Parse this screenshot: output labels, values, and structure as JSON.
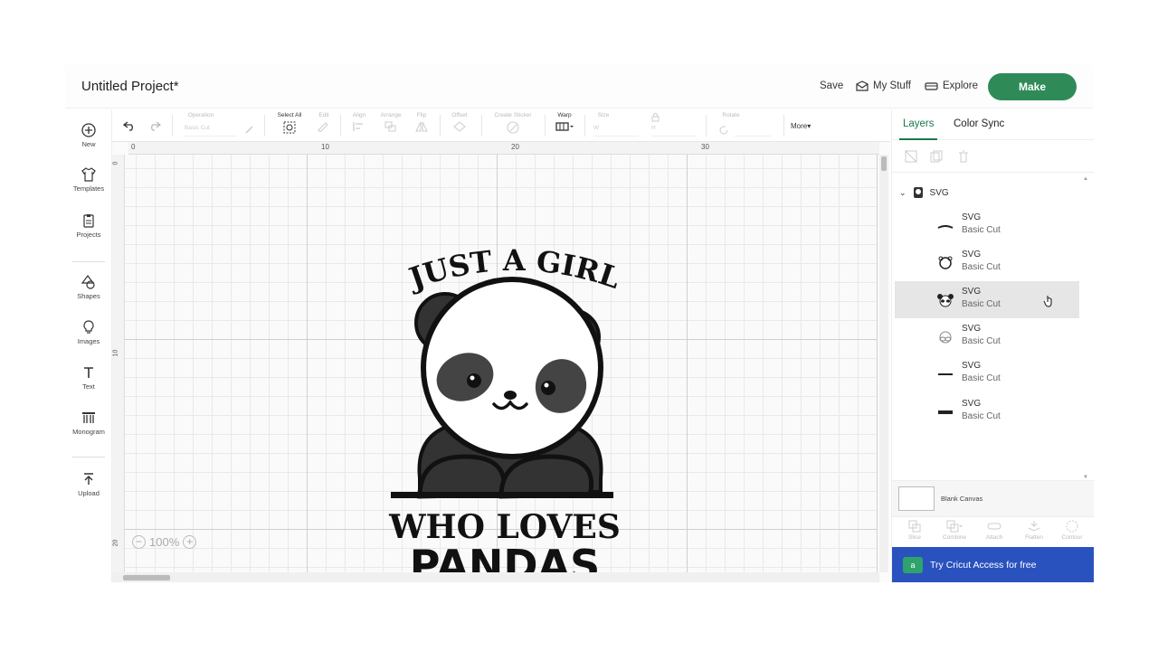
{
  "header": {
    "project_title": "Untitled Project*",
    "save_label": "Save",
    "my_stuff_label": "My Stuff",
    "explore_label": "Explore",
    "make_label": "Make"
  },
  "sidebar": {
    "items": [
      {
        "label": "New",
        "icon": "plus-circle-icon"
      },
      {
        "label": "Templates",
        "icon": "shirt-icon"
      },
      {
        "label": "Projects",
        "icon": "clipboard-icon"
      },
      {
        "label": "Shapes",
        "icon": "shapes-icon"
      },
      {
        "label": "Images",
        "icon": "lightbulb-icon"
      },
      {
        "label": "Text",
        "icon": "text-icon"
      },
      {
        "label": "Monogram",
        "icon": "monogram-icon"
      },
      {
        "label": "Upload",
        "icon": "upload-icon"
      }
    ]
  },
  "toolbar": {
    "operation_label": "Operation",
    "operation_value": "Basic Cut",
    "select_all_label": "Select All",
    "edit_label": "Edit",
    "align_label": "Align",
    "arrange_label": "Arrange",
    "flip_label": "Flip",
    "offset_label": "Offset",
    "create_sticker_label": "Create Sticker",
    "warp_label": "Warp",
    "size_label": "Size",
    "size_w": "W",
    "size_h": "H",
    "rotate_label": "Rotate",
    "more_label": "More"
  },
  "canvas": {
    "ruler_top": [
      "0",
      "10",
      "20",
      "30"
    ],
    "ruler_left": [
      "0",
      "10",
      "20"
    ],
    "zoom_minus": "−",
    "zoom_level": "100%",
    "zoom_plus": "+",
    "design": {
      "line1": "JUST A GIRL",
      "line2": "WHO LOVES",
      "line3": "PANDAS"
    }
  },
  "right_panel": {
    "tabs": [
      "Layers",
      "Color Sync"
    ],
    "active_tab": "Layers",
    "group_name": "SVG",
    "layers": [
      {
        "name": "SVG",
        "operation": "Basic Cut",
        "thumb": "text-arc-icon",
        "selected": false
      },
      {
        "name": "SVG",
        "operation": "Basic Cut",
        "thumb": "panda-outline-icon",
        "selected": false
      },
      {
        "name": "SVG",
        "operation": "Basic Cut",
        "thumb": "panda-face-icon",
        "selected": true
      },
      {
        "name": "SVG",
        "operation": "Basic Cut",
        "thumb": "paws-icon",
        "selected": false
      },
      {
        "name": "SVG",
        "operation": "Basic Cut",
        "thumb": "text-small-icon",
        "selected": false
      },
      {
        "name": "SVG",
        "operation": "Basic Cut",
        "thumb": "text-bold-icon",
        "selected": false
      }
    ],
    "blank_canvas_label": "Blank Canvas",
    "actions": [
      "Slice",
      "Combine",
      "Attach",
      "Flatten",
      "Contour"
    ],
    "access_label": "Try Cricut Access for free",
    "access_badge": "a"
  },
  "colors": {
    "make_button": "#2e8b57",
    "active_tab": "#1a7a4a",
    "access_banner": "#2a52be"
  }
}
